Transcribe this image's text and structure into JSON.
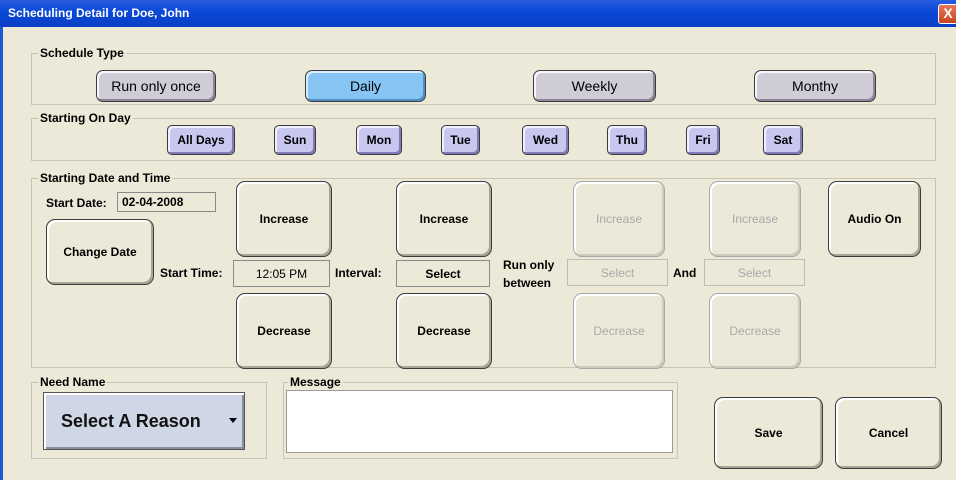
{
  "window": {
    "title": "Scheduling Detail for Doe, John",
    "close_glyph": "X"
  },
  "schedule_type": {
    "label": "Schedule Type",
    "options": [
      "Run only once",
      "Daily",
      "Weekly",
      "Monthy"
    ],
    "selected": "Daily"
  },
  "starting_on_day": {
    "label": "Starting On Day",
    "days": [
      "All Days",
      "Sun",
      "Mon",
      "Tue",
      "Wed",
      "Thu",
      "Fri",
      "Sat"
    ]
  },
  "date_time": {
    "label": "Starting Date and Time",
    "start_date_label": "Start Date:",
    "start_date": "02-04-2008",
    "change_date": "Change Date",
    "start_time_label": "Start Time:",
    "start_time": "12:05 PM",
    "interval_label": "Interval:",
    "interval_value": "Select",
    "run_only_between": "Run only between",
    "between_from": "Select",
    "and_label": "And",
    "between_to": "Select",
    "increase": "Increase",
    "decrease": "Decrease",
    "audio": "Audio On"
  },
  "need_name": {
    "label": "Need Name",
    "value": "Select A Reason"
  },
  "message": {
    "label": "Message",
    "value": ""
  },
  "actions": {
    "save": "Save",
    "cancel": "Cancel"
  },
  "colors": {
    "titlebar": "#0a49d8",
    "selected_button": "#86c4f4",
    "day_button": "#c9c7f0",
    "background": "#ece9d8"
  }
}
